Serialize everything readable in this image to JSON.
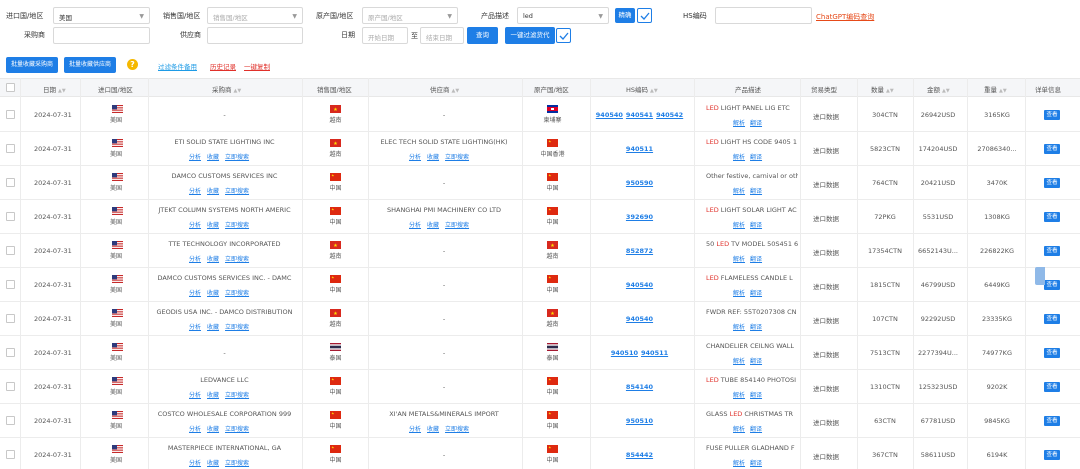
{
  "filters": {
    "import_country_label": "进口国/地区",
    "import_country_value": "美国",
    "sales_country_label": "销售国/地区",
    "sales_country_placeholder": "销售国/地区",
    "origin_country_label": "原产国/地区",
    "origin_country_placeholder": "原产国/地区",
    "product_desc_label": "产品描述",
    "product_desc_value": "led",
    "fuzzy_label": "精确",
    "hs_label": "HS编码",
    "chatgpt_link": "ChatGPT编码查询",
    "buyer_label": "采购商",
    "supplier_label": "供应商",
    "date_label": "日期",
    "start_date_placeholder": "开始日期",
    "to_label": "至",
    "end_date_placeholder": "结束日期",
    "search_label": "查询",
    "filter_proxy_label": "一键过滤货代"
  },
  "toolbar": {
    "batch_buyer": "批量收藏采购商",
    "batch_supplier": "批量收藏供应商",
    "help": "?",
    "filter_history": "过滤条件备用",
    "history": "历史记录",
    "one_click": "一键复制"
  },
  "colors": {
    "accent": "#1e7ee6",
    "red": "#e0302a",
    "gpt": "#e64a19"
  },
  "table": {
    "headers": [
      "日期",
      "进口国/地区",
      "采购商",
      "销售国/地区",
      "供应商",
      "原产国/地区",
      "HS编码",
      "产品描述",
      "贸易类型",
      "数量",
      "金额",
      "重量",
      "详单信息"
    ],
    "actions": [
      "分析",
      "收藏",
      "立即搜索"
    ],
    "desc_actions": [
      "解析",
      "翻译"
    ],
    "view_label": "查看",
    "rows": [
      {
        "date": "2024-07-31",
        "imp": "美国",
        "buyer": "-",
        "sales": "越南",
        "sales_flag": "vn",
        "supplier": "-",
        "origin": "柬埔寨",
        "origin_flag": "kh",
        "hs": [
          "940540",
          "940541",
          "940542"
        ],
        "desc_pre": "",
        "desc_led": "LED",
        "desc_post": " LIGHT PANEL LIG ETC",
        "trade": "进口数据",
        "qty": "304CTN",
        "amt": "26942USD",
        "wt": "3165KG",
        "buyer_acts": false,
        "sup_acts": false,
        "desc_acts": true
      },
      {
        "date": "2024-07-31",
        "imp": "美国",
        "buyer": "ETI SOLID STATE LIGHTING INC",
        "sales": "越南",
        "sales_flag": "vn",
        "supplier": "ELEC TECH SOLID STATE LIGHTING(HK)",
        "origin": "中国香港",
        "origin_flag": "cn",
        "hs": [
          "940511"
        ],
        "desc_pre": "",
        "desc_led": "LED",
        "desc_post": " LIGHT HS CODE 9405 1",
        "trade": "进口数据",
        "qty": "5823CTN",
        "amt": "174204USD",
        "wt": "27086340...",
        "buyer_acts": true,
        "sup_acts": true,
        "desc_acts": true
      },
      {
        "date": "2024-07-31",
        "imp": "美国",
        "buyer": "DAMCO CUSTOMS SERVICES INC",
        "sales": "中国",
        "sales_flag": "cn",
        "supplier": "-",
        "origin": "中国",
        "origin_flag": "cn",
        "hs": [
          "950590"
        ],
        "desc_pre": "Other festive, carnival or other",
        "desc_led": "",
        "desc_post": "",
        "trade": "进口数据",
        "qty": "764CTN",
        "amt": "20421USD",
        "wt": "3470K",
        "buyer_acts": true,
        "sup_acts": false,
        "desc_acts": true
      },
      {
        "date": "2024-07-31",
        "imp": "美国",
        "buyer": "JTEKT COLUMN SYSTEMS NORTH AMERIC",
        "sales": "中国",
        "sales_flag": "cn",
        "supplier": "SHANGHAI PMI MACHINERY CO LTD",
        "origin": "中国",
        "origin_flag": "cn",
        "hs": [
          "392690"
        ],
        "desc_pre": "",
        "desc_led": "LED",
        "desc_post": " LIGHT SOLAR LIGHT AC",
        "trade": "进口数据",
        "qty": "72PKG",
        "amt": "5531USD",
        "wt": "1308KG",
        "buyer_acts": true,
        "sup_acts": true,
        "desc_acts": true
      },
      {
        "date": "2024-07-31",
        "imp": "美国",
        "buyer": "TTE TECHNOLOGY INCORPORATED",
        "sales": "越南",
        "sales_flag": "vn",
        "supplier": "-",
        "origin": "越南",
        "origin_flag": "vn",
        "hs": [
          "852872"
        ],
        "desc_pre": "50 ",
        "desc_led": "LED",
        "desc_post": " TV MODEL 50S451 6",
        "trade": "进口数据",
        "qty": "17354CTN",
        "amt": "6652143U...",
        "wt": "226822KG",
        "buyer_acts": true,
        "sup_acts": false,
        "desc_acts": true
      },
      {
        "date": "2024-07-31",
        "imp": "美国",
        "buyer": "DAMCO CUSTOMS SERVICES INC. - DAMC",
        "sales": "中国",
        "sales_flag": "cn",
        "supplier": "-",
        "origin": "中国",
        "origin_flag": "cn",
        "hs": [
          "940540"
        ],
        "desc_pre": "",
        "desc_led": "LED",
        "desc_post": " FLAMELESS CANDLE L",
        "trade": "进口数据",
        "qty": "1815CTN",
        "amt": "46799USD",
        "wt": "6449KG",
        "buyer_acts": true,
        "sup_acts": false,
        "desc_acts": true
      },
      {
        "date": "2024-07-31",
        "imp": "美国",
        "buyer": "GEODIS USA INC. - DAMCO DISTRIBUTION",
        "sales": "越南",
        "sales_flag": "vn",
        "supplier": "-",
        "origin": "越南",
        "origin_flag": "vn",
        "hs": [
          "940540"
        ],
        "desc_pre": "FWDR REF: 55T0207308 CN",
        "desc_led": "",
        "desc_post": "",
        "trade": "进口数据",
        "qty": "107CTN",
        "amt": "92292USD",
        "wt": "23335KG",
        "buyer_acts": true,
        "sup_acts": false,
        "desc_acts": true
      },
      {
        "date": "2024-07-31",
        "imp": "美国",
        "buyer": "-",
        "sales": "泰国",
        "sales_flag": "th",
        "supplier": "-",
        "origin": "泰国",
        "origin_flag": "th",
        "hs": [
          "940510",
          "940511"
        ],
        "desc_pre": "CHANDELIER CEILNG WALL",
        "desc_led": "",
        "desc_post": "",
        "trade": "进口数据",
        "qty": "7513CTN",
        "amt": "2277394U...",
        "wt": "74977KG",
        "buyer_acts": false,
        "sup_acts": false,
        "desc_acts": true
      },
      {
        "date": "2024-07-31",
        "imp": "美国",
        "buyer": "LEDVANCE LLC",
        "sales": "中国",
        "sales_flag": "cn",
        "supplier": "-",
        "origin": "中国",
        "origin_flag": "cn",
        "hs": [
          "854140"
        ],
        "desc_pre": "",
        "desc_led": "LED",
        "desc_post": " TUBE 854140 PHOTOSI",
        "trade": "进口数据",
        "qty": "1310CTN",
        "amt": "125323USD",
        "wt": "9202K",
        "buyer_acts": true,
        "sup_acts": false,
        "desc_acts": true
      },
      {
        "date": "2024-07-31",
        "imp": "美国",
        "buyer": "COSTCO WHOLESALE CORPORATION 999",
        "sales": "中国",
        "sales_flag": "cn",
        "supplier": "XI'AN METALS&MINERALS IMPORT",
        "origin": "中国",
        "origin_flag": "cn",
        "hs": [
          "950510"
        ],
        "desc_pre": "GLASS ",
        "desc_led": "LED",
        "desc_post": " CHRISTMAS TR",
        "trade": "进口数据",
        "qty": "63CTN",
        "amt": "67781USD",
        "wt": "9845KG",
        "buyer_acts": true,
        "sup_acts": true,
        "desc_acts": true
      },
      {
        "date": "2024-07-31",
        "imp": "美国",
        "buyer": "MASTERPIECE INTERNATIONAL, GA",
        "sales": "中国",
        "sales_flag": "cn",
        "supplier": "-",
        "origin": "中国",
        "origin_flag": "cn",
        "hs": [
          "854442"
        ],
        "desc_pre": "FUSE PULLER GLADHAND F",
        "desc_led": "",
        "desc_post": "",
        "trade": "进口数据",
        "qty": "367CTN",
        "amt": "58611USD",
        "wt": "6194K",
        "buyer_acts": true,
        "sup_acts": false,
        "desc_acts": true
      }
    ]
  }
}
